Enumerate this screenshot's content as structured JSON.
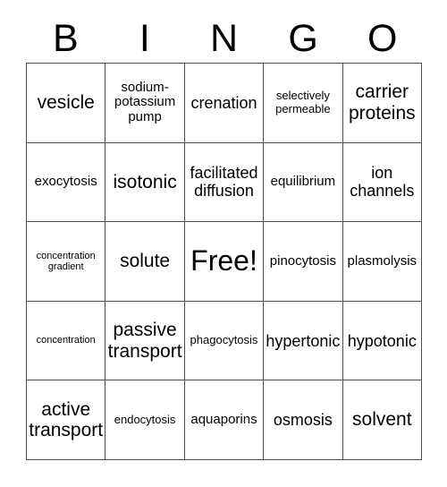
{
  "card": {
    "title_letters": [
      "B",
      "I",
      "N",
      "G",
      "O"
    ],
    "columns": 5,
    "rows": 5,
    "free_space": {
      "row": 3,
      "column": 3,
      "label": "Free!"
    },
    "colors": {
      "background": "#ffffff",
      "text": "#000000",
      "grid_line": "#4d4d4d"
    },
    "cells": [
      [
        {
          "label": "vesicle",
          "size": "xl"
        },
        {
          "label": "sodium-potassium pump",
          "size": "m"
        },
        {
          "label": "crenation",
          "size": "l"
        },
        {
          "label": "selectively permeable",
          "size": "s"
        },
        {
          "label": "carrier proteins",
          "size": "xl"
        }
      ],
      [
        {
          "label": "exocytosis",
          "size": "m"
        },
        {
          "label": "isotonic",
          "size": "xl"
        },
        {
          "label": "facilitated diffusion",
          "size": "l"
        },
        {
          "label": "equilibrium",
          "size": "m"
        },
        {
          "label": "ion channels",
          "size": "l"
        }
      ],
      [
        {
          "label": "concentration gradient",
          "size": "xs"
        },
        {
          "label": "solute",
          "size": "xl"
        },
        {
          "label": "Free!",
          "size": "free"
        },
        {
          "label": "pinocytosis",
          "size": "m"
        },
        {
          "label": "plasmolysis",
          "size": "m"
        }
      ],
      [
        {
          "label": "concentration",
          "size": "xs"
        },
        {
          "label": "passive transport",
          "size": "xl"
        },
        {
          "label": "phagocytosis",
          "size": "s"
        },
        {
          "label": "hypertonic",
          "size": "l"
        },
        {
          "label": "hypotonic",
          "size": "l"
        }
      ],
      [
        {
          "label": "active transport",
          "size": "xl"
        },
        {
          "label": "endocytosis",
          "size": "s"
        },
        {
          "label": "aquaporins",
          "size": "m"
        },
        {
          "label": "osmosis",
          "size": "l"
        },
        {
          "label": "solvent",
          "size": "xl"
        }
      ]
    ]
  }
}
